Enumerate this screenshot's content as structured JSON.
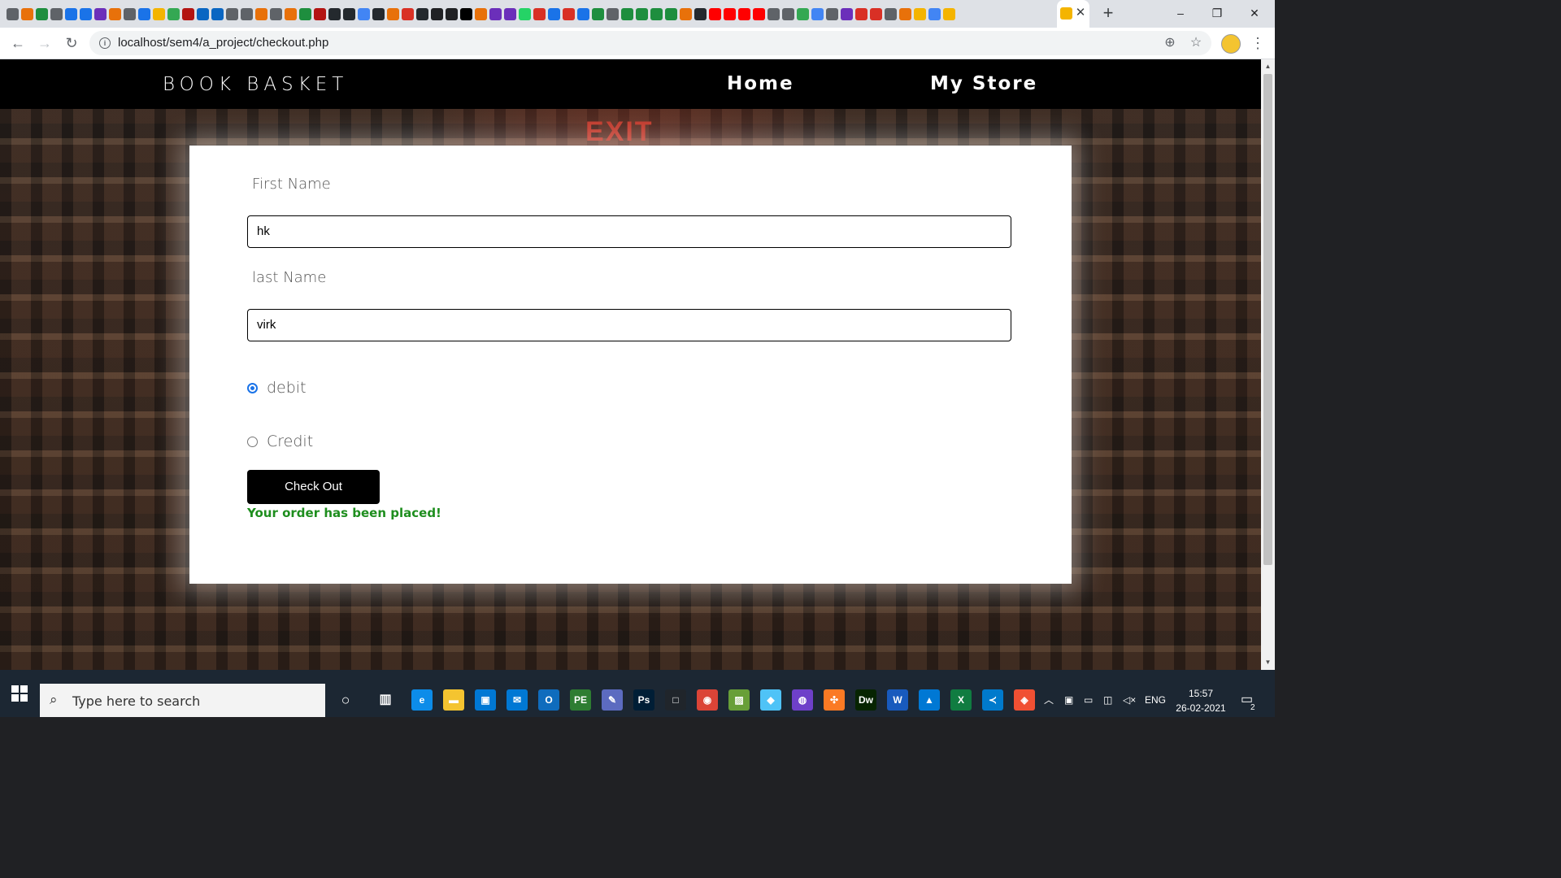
{
  "browser": {
    "url": "localhost/sem4/a_project/checkout.php",
    "tab_close_glyph": "✕",
    "new_tab_glyph": "+",
    "favicon_colors": [
      "#5f6368",
      "#e8710a",
      "#1e8e3e",
      "#5f6368",
      "#1a73e8",
      "#1a73e8",
      "#6b2fba",
      "#e8710a",
      "#5f6368",
      "#1a73e8",
      "#f4b400",
      "#34a853",
      "#b31412",
      "#0a66c2",
      "#0a66c2",
      "#5f6368",
      "#5f6368",
      "#e8710a",
      "#5f6368",
      "#e8710a",
      "#1e8e3e",
      "#b31412",
      "#24292e",
      "#24292e",
      "#4285f4",
      "#24292e",
      "#e8710a",
      "#d93025",
      "#24292e",
      "#202124",
      "#202124",
      "#000000",
      "#e8710a",
      "#6b2fba",
      "#6b2fba",
      "#25d366",
      "#d93025",
      "#1a73e8",
      "#d93025",
      "#1a73e8",
      "#1e8e3e",
      "#5f6368",
      "#1e8e3e",
      "#1e8e3e",
      "#1e8e3e",
      "#1e8e3e",
      "#e8710a",
      "#24292e",
      "#ff0000",
      "#ff0000",
      "#ff0000",
      "#ff0000",
      "#5f6368",
      "#5f6368",
      "#34a853",
      "#4285f4",
      "#5f6368",
      "#6b2fba",
      "#d93025",
      "#d93025",
      "#5f6368",
      "#e8710a",
      "#f4b400",
      "#4285f4",
      "#f4b400"
    ]
  },
  "site": {
    "brand": "BOOK BASKET",
    "nav": {
      "home": "Home",
      "store": "My Store"
    },
    "background_sign": "EXIT"
  },
  "form": {
    "first_name_label": "First Name",
    "first_name_value": "hk",
    "last_name_label": "last Name",
    "last_name_value": "virk",
    "payment_options": [
      {
        "label": "debit",
        "checked": true
      },
      {
        "label": "Credit",
        "checked": false
      }
    ],
    "checkout_button": "Check Out",
    "success_message": "Your order has been placed!",
    "success_color": "#1e8e1e"
  },
  "taskbar": {
    "search_placeholder": "Type here to search",
    "tray_language": "ENG",
    "time": "15:57",
    "date": "26-02-2021",
    "notification_count": "2",
    "apps": [
      {
        "name": "edge-icon",
        "label": "e",
        "color": "#0c8ce9"
      },
      {
        "name": "file-explorer-icon",
        "label": "▬",
        "color": "#f4c430"
      },
      {
        "name": "store-icon",
        "label": "▣",
        "color": "#0078d4"
      },
      {
        "name": "mail-icon",
        "label": "✉",
        "color": "#0078d4"
      },
      {
        "name": "outlook-icon",
        "label": "O",
        "color": "#0f6cbd"
      },
      {
        "name": "pe-icon",
        "label": "PE",
        "color": "#2e7d32"
      },
      {
        "name": "paint-icon",
        "label": "✎",
        "color": "#5c6bc0"
      },
      {
        "name": "photoshop-icon",
        "label": "Ps",
        "color": "#001e36"
      },
      {
        "name": "ide-icon",
        "label": "□",
        "color": "#20252b"
      },
      {
        "name": "chrome-icon",
        "label": "◉",
        "color": "#db4437"
      },
      {
        "name": "image-viewer-icon",
        "label": "▨",
        "color": "#689f38"
      },
      {
        "name": "notes-icon",
        "label": "◆",
        "color": "#4fc3f7"
      },
      {
        "name": "github-icon",
        "label": "◍",
        "color": "#6e40c9"
      },
      {
        "name": "xampp-icon",
        "label": "✣",
        "color": "#fb7a24"
      },
      {
        "name": "dreamweaver-icon",
        "label": "Dw",
        "color": "#072401"
      },
      {
        "name": "word-icon",
        "label": "W",
        "color": "#185abd"
      },
      {
        "name": "photos-icon",
        "label": "▲",
        "color": "#0078d4"
      },
      {
        "name": "excel-icon",
        "label": "X",
        "color": "#107c41"
      },
      {
        "name": "vscode-icon",
        "label": "≺",
        "color": "#007acc"
      },
      {
        "name": "git-icon",
        "label": "◈",
        "color": "#f05033"
      }
    ]
  }
}
